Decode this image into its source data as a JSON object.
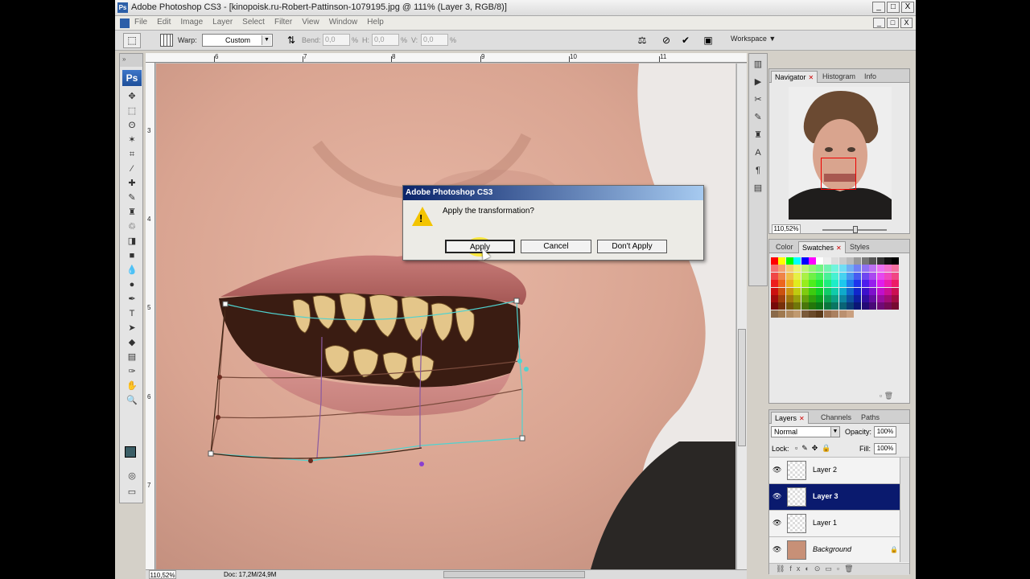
{
  "window": {
    "title": "Adobe Photoshop CS3 - [kinopoisk.ru-Robert-Pattinson-1079195.jpg @ 111% (Layer 3, RGB/8)]",
    "minimize": "_",
    "maximize": "□",
    "close": "X"
  },
  "menu": [
    "File",
    "Edit",
    "Image",
    "Layer",
    "Select",
    "Filter",
    "View",
    "Window",
    "Help"
  ],
  "options": {
    "warp_label": "Warp:",
    "warp_value": "Custom",
    "bend_label": "Bend:",
    "bend_value": "0,0",
    "percent": "%",
    "h_label": "H:",
    "h_value": "0,0",
    "v_label": "V:",
    "v_value": "0,0",
    "workspace": "Workspace ▼"
  },
  "toolbox": {
    "logo": "Ps"
  },
  "rulers": {
    "top": [
      "6",
      "7",
      "8",
      "9",
      "10",
      "11"
    ],
    "left": [
      "3",
      "4",
      "5",
      "6",
      "7"
    ]
  },
  "status": {
    "zoom": "110,52%",
    "doc": "Doc: 17,2M/24,9M"
  },
  "dialog": {
    "title": "Adobe Photoshop CS3",
    "message": "Apply the transformation?",
    "warning_mark": "!",
    "apply": "Apply",
    "cancel": "Cancel",
    "dont_apply": "Don't Apply"
  },
  "navigator_panel": {
    "tabs": [
      "Navigator",
      "Histogram",
      "Info"
    ],
    "zoom": "110,52%"
  },
  "swatches_panel": {
    "tabs": [
      "Color",
      "Swatches",
      "Styles"
    ]
  },
  "layers_panel": {
    "tabs": [
      "Layers",
      "Channels",
      "Paths"
    ],
    "blend_mode": "Normal",
    "opacity_label": "Opacity:",
    "opacity": "100%",
    "lock_label": "Lock:",
    "fill_label": "Fill:",
    "fill": "100%",
    "layers": [
      {
        "name": "Layer 2",
        "selected": false
      },
      {
        "name": "Layer 3",
        "selected": true
      },
      {
        "name": "Layer 1",
        "selected": false
      },
      {
        "name": "Background",
        "selected": false
      }
    ]
  },
  "colors": {
    "dialog_title_start": "#0a246a",
    "dialog_title_end": "#a6caf0",
    "selected_layer": "#0a1a6e",
    "highlight": "#ffe61e",
    "foreground_swatch": "#3b5e66"
  }
}
